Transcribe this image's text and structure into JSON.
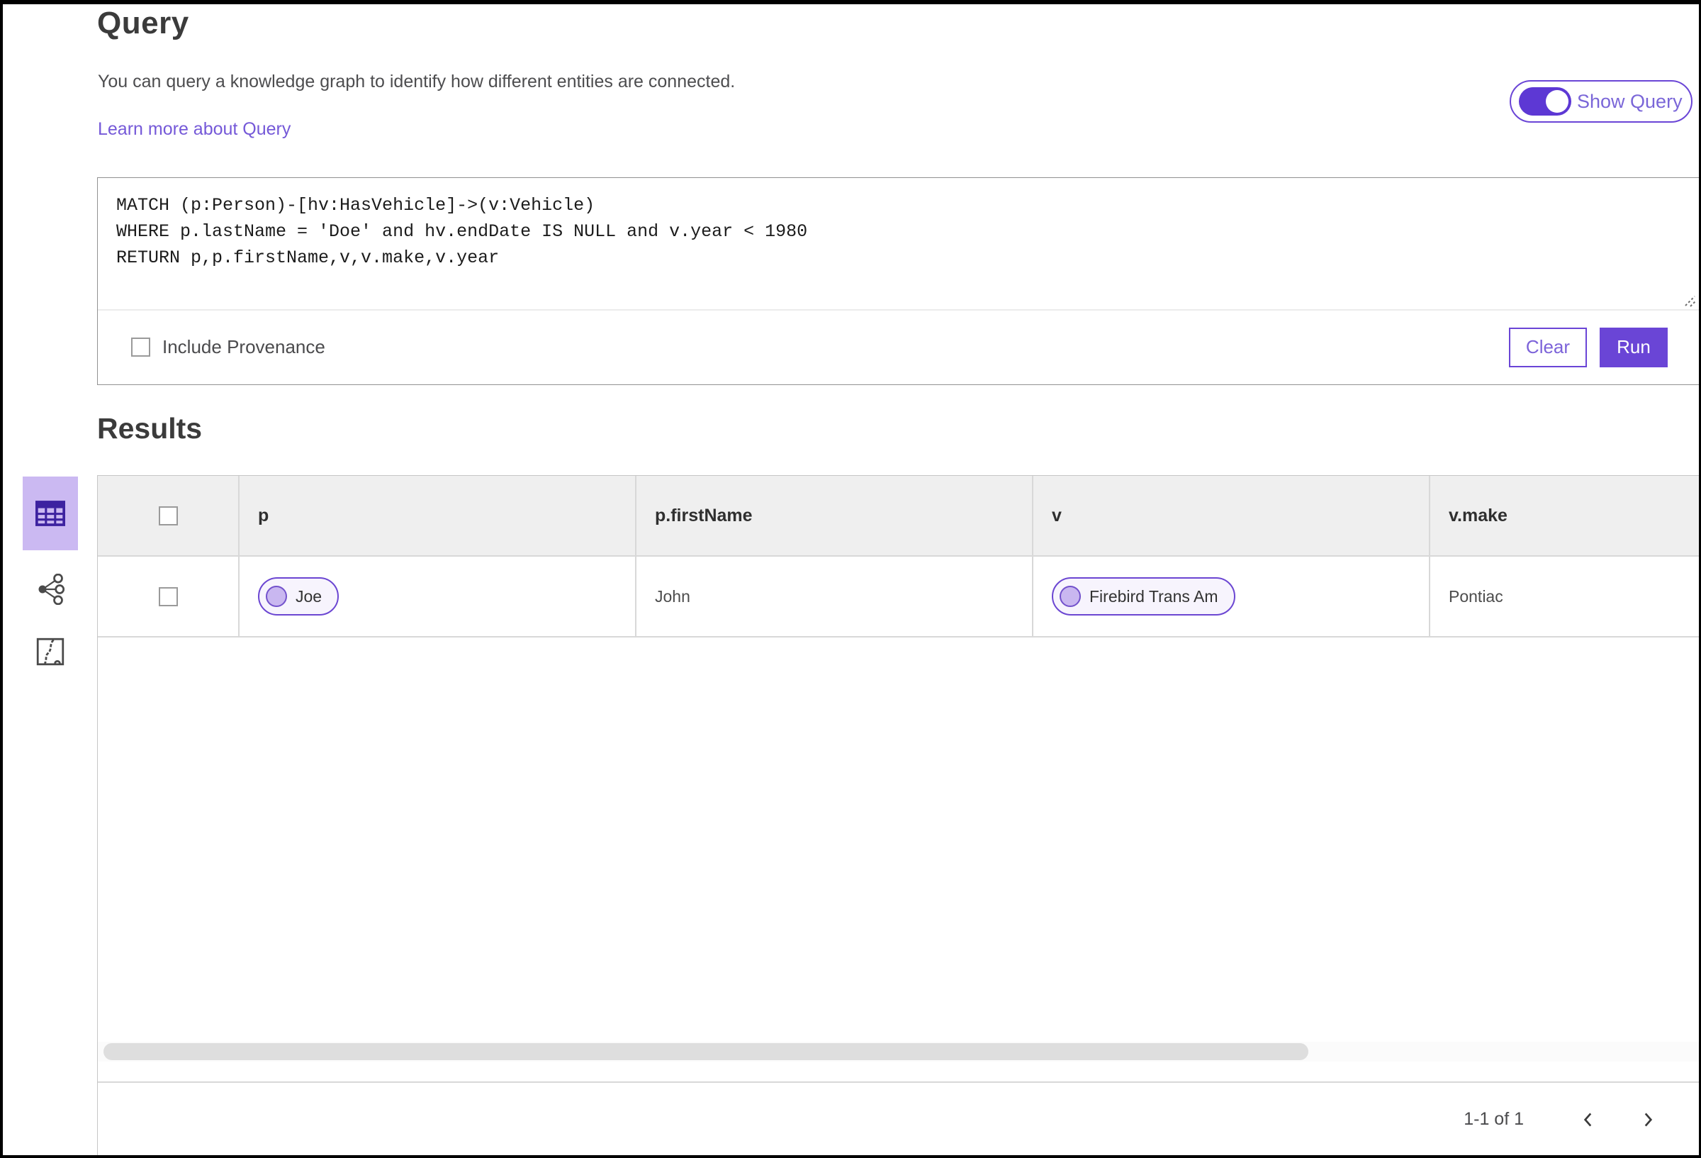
{
  "header": {
    "title": "Query",
    "description": "You can query a knowledge graph to identify how different entities are connected.",
    "learn_more_link": "Learn more about Query",
    "show_query_label": "Show Query",
    "show_query_on": true
  },
  "query": {
    "code": "MATCH (p:Person)-[hv:HasVehicle]->(v:Vehicle)\nWHERE p.lastName = 'Doe' and hv.endDate IS NULL and v.year < 1980\nRETURN p,p.firstName,v,v.make,v.year",
    "include_provenance_label": "Include Provenance",
    "include_provenance_checked": false,
    "buttons": {
      "clear": "Clear",
      "run": "Run"
    }
  },
  "results": {
    "heading": "Results",
    "views": [
      {
        "name": "table-view",
        "icon": "table-icon",
        "selected": true
      },
      {
        "name": "link-chart-view",
        "icon": "link-chart-icon",
        "selected": false
      },
      {
        "name": "map-view",
        "icon": "map-icon",
        "selected": false
      }
    ],
    "table": {
      "columns": [
        "p",
        "p.firstName",
        "v",
        "v.make"
      ],
      "rows": [
        {
          "selected": false,
          "cells": [
            {
              "kind": "chip",
              "label": "Joe"
            },
            {
              "kind": "text",
              "label": "John"
            },
            {
              "kind": "chip",
              "label": "Firebird Trans Am"
            },
            {
              "kind": "text",
              "label": "Pontiac"
            }
          ]
        }
      ]
    },
    "pagination": {
      "range_label": "1-1 of 1"
    }
  },
  "colors": {
    "primary_purple": "#6a45d6",
    "toggle_track": "#5d38d4",
    "link_purple": "#7559d8",
    "selected_tab_bg": "#cbb9f2",
    "tab_icon_dark_purple": "#3d22a0",
    "chip_bg": "#f7f4fd",
    "chip_dot_fill": "#c9b7f0",
    "table_header_bg": "#efefef",
    "border_gray": "#d8d8d8"
  }
}
